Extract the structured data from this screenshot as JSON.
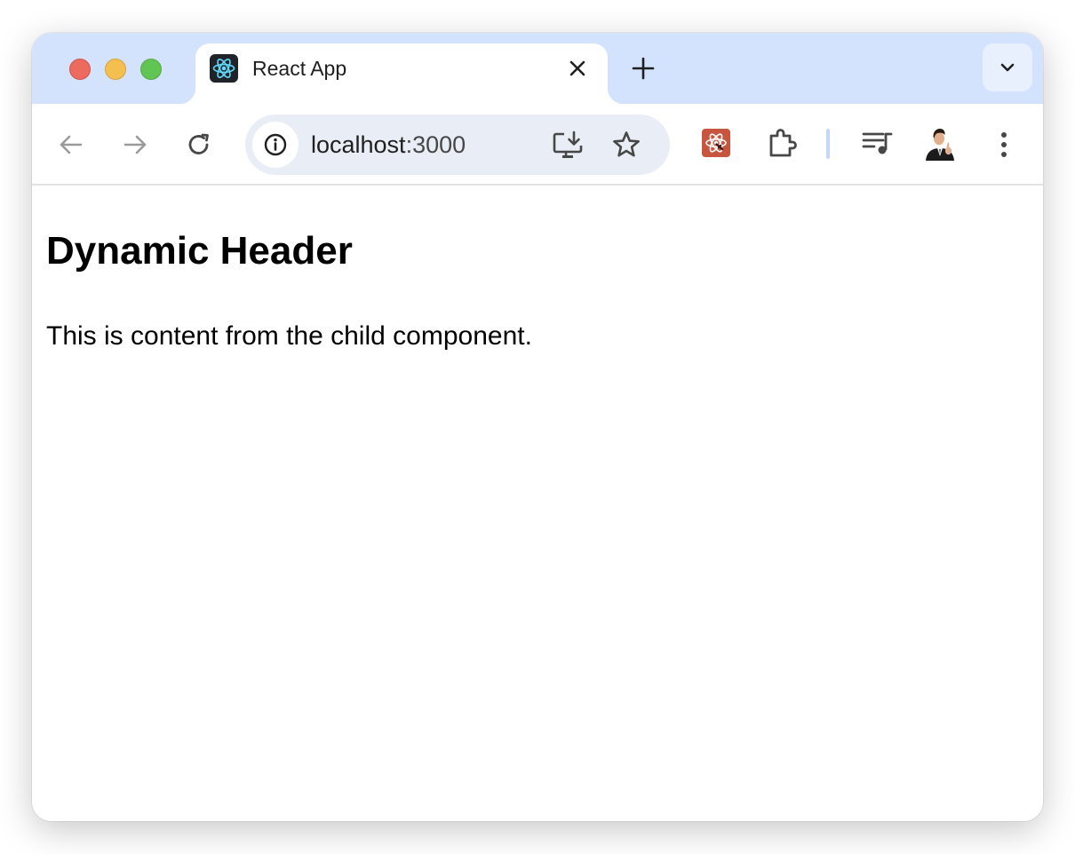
{
  "browser": {
    "tab": {
      "title": "React App"
    },
    "address_bar": {
      "host": "localhost",
      "port": ":3000"
    }
  },
  "page": {
    "heading": "Dynamic Header",
    "paragraph": "This is content from the child component."
  },
  "colors": {
    "titlebar_bg": "#d3e3fd",
    "omnibox_bg": "#e9eef6",
    "traffic_close": "#ed6a5e",
    "traffic_minimize": "#f5bf4f",
    "traffic_maximize": "#61c554",
    "react_blue": "#61dafb"
  },
  "icons": {
    "tab_favicon": "react-logo-icon",
    "tab_close": "close-icon",
    "new_tab": "plus-icon",
    "tab_search": "chevron-down-icon",
    "back": "arrow-left-icon",
    "forward": "arrow-right-icon",
    "reload": "reload-icon",
    "site_info": "info-icon",
    "install_app": "install-app-icon",
    "bookmark": "star-icon",
    "react_devtools": "react-devtools-extension-icon",
    "extensions": "puzzle-icon",
    "media_controls": "media-queue-icon",
    "profile": "profile-avatar",
    "menu": "more-vertical-icon"
  }
}
